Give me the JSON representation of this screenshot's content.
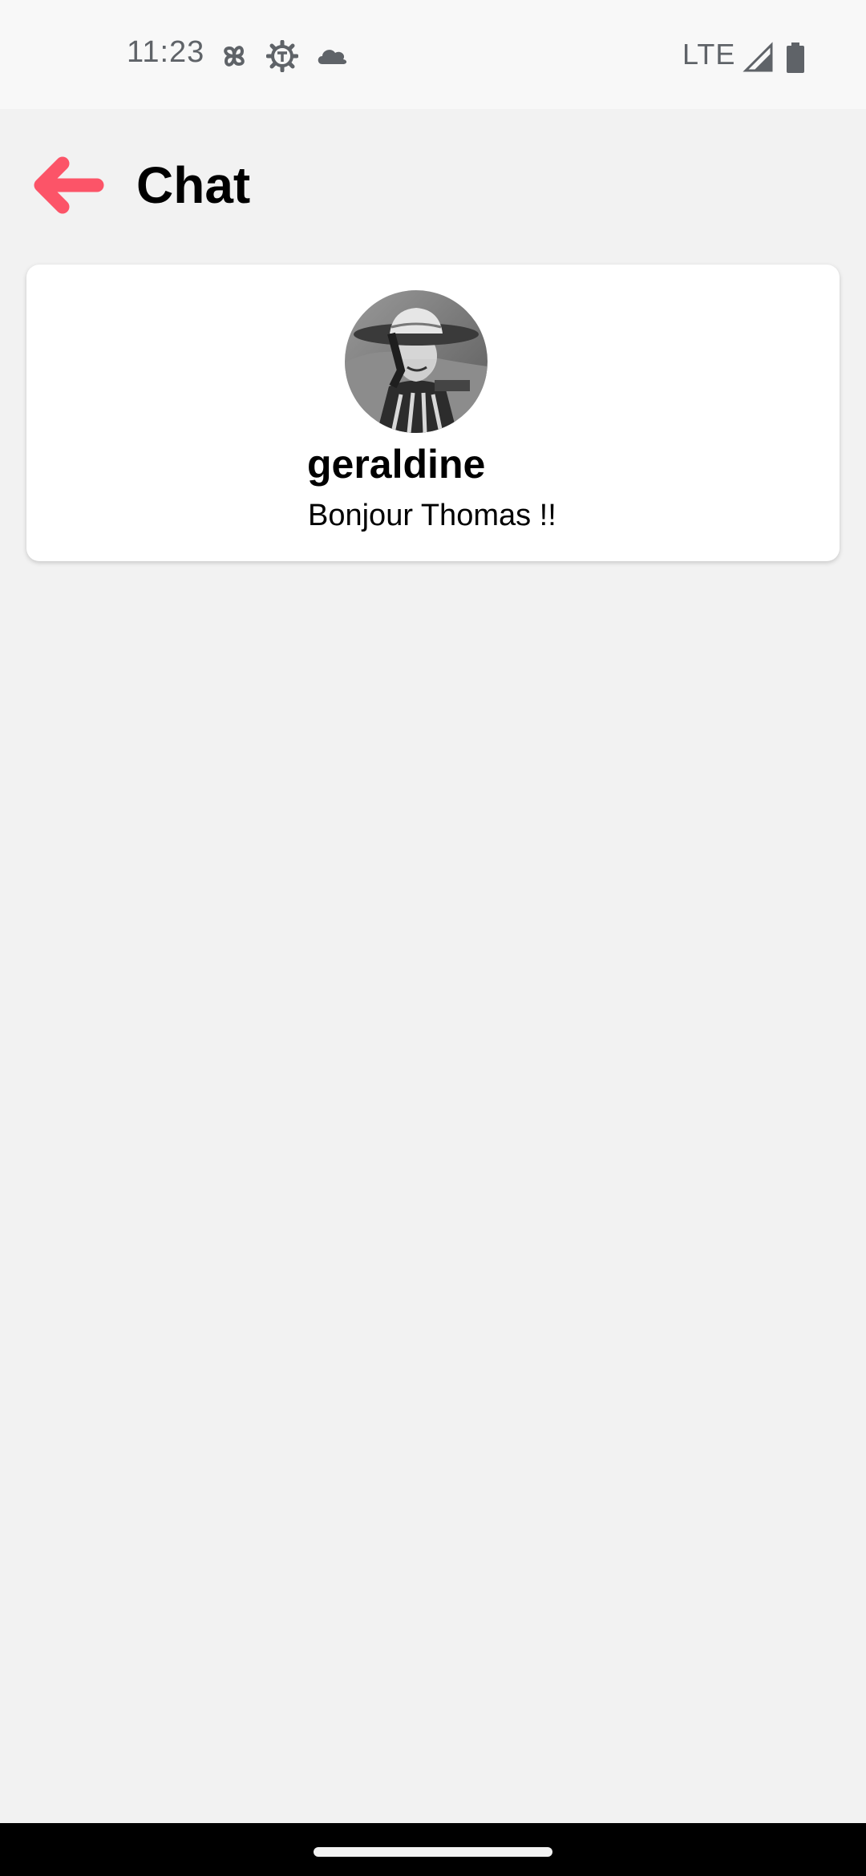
{
  "status_bar": {
    "time": "11:23",
    "network": "LTE",
    "icons": [
      "pinwheel-icon",
      "gear-icon",
      "cloud-icon",
      "signal-icon",
      "battery-icon"
    ]
  },
  "header": {
    "title": "Chat",
    "back_icon": "back-arrow-icon",
    "accent_color": "#fc5468"
  },
  "chats": [
    {
      "name": "geraldine",
      "last_message": "Bonjour Thomas !!",
      "avatar": "avatar-photo"
    }
  ],
  "colors": {
    "background": "#f2f2f2",
    "card": "#ffffff",
    "nav_bar": "#000000"
  }
}
